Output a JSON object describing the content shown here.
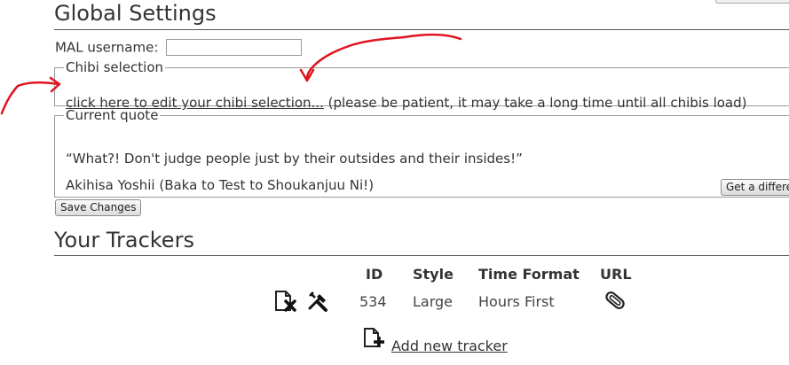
{
  "global": {
    "title": "Global Settings",
    "mal_label": "MAL username:",
    "mal_value": "",
    "chibi_legend": "Chibi selection",
    "chibi_link": "click here to edit your chibi selection...",
    "chibi_note": " (please be patient, it may take a long time until all chibis load)",
    "quote_legend": "Current quote",
    "quote_text": "“What?! Don't judge people just by their outsides and their insides!”",
    "quote_author": "Akihisa Yoshii (Baka to Test to Shoukanjuu Ni!)",
    "new_quote_button": "Get a different quote",
    "save_button": "Save Changes"
  },
  "trackers": {
    "title": "Your Trackers",
    "columns": [
      "ID",
      "Style",
      "Time Format",
      "URL"
    ],
    "rows": [
      {
        "id": "534",
        "style": "Large",
        "time_format": "Hours First",
        "icons": [
          "delete-icon",
          "edit-icon",
          "url-icon"
        ]
      }
    ],
    "add_link": "Add new tracker",
    "add_icon": "add-page-icon"
  },
  "annotations": {
    "arrow_color": "#e0141e"
  }
}
